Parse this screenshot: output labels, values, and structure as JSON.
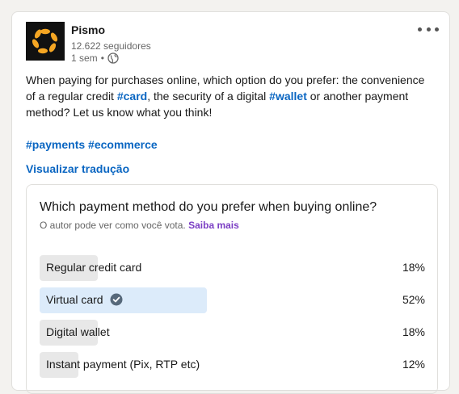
{
  "post": {
    "company": "Pismo",
    "followers": "12.622 seguidores",
    "time": "1 sem",
    "separator": "•",
    "body_part1": "When paying for purchases online, which option do you prefer: the convenience of a regular credit ",
    "tag_card": "#card",
    "body_part2": ", the security of a digital ",
    "tag_wallet": "#wallet",
    "body_part3": " or another payment method? Let us know what you think!",
    "hashtag1": "#payments",
    "hashtag2": "#ecommerce",
    "translate": "Visualizar tradução",
    "icons": {
      "logo": "pismo-logo",
      "more": "more-icon",
      "visibility": "globe-icon"
    }
  },
  "poll": {
    "question": "Which payment method do you prefer when buying online?",
    "note": "O autor pode ver como você vota.",
    "learn_more": "Saiba mais",
    "options": [
      {
        "label": "Regular credit card",
        "percent": "18%",
        "value": 18,
        "selected": false
      },
      {
        "label": "Virtual card",
        "percent": "52%",
        "value": 52,
        "selected": true
      },
      {
        "label": "Digital wallet",
        "percent": "18%",
        "value": 18,
        "selected": false
      },
      {
        "label": "Instant payment (Pix, RTP etc)",
        "percent": "12%",
        "value": 12,
        "selected": false
      }
    ]
  },
  "colors": {
    "link": "#0a66c2",
    "learn_more": "#7b3fc4",
    "bar": "#e8e8e8",
    "bar_selected": "#dcebfa",
    "logo_orange": "#f5a623"
  }
}
